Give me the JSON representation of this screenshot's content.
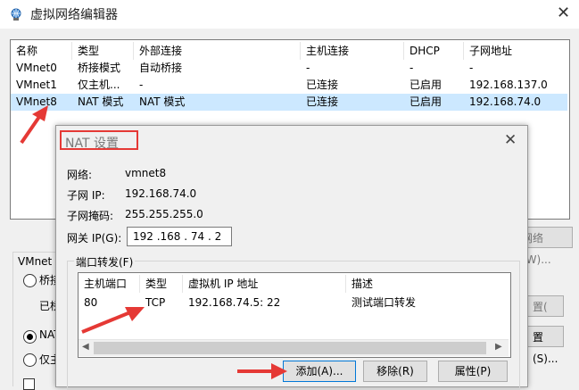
{
  "window": {
    "title": "虚拟网络编辑器",
    "close_glyph": "✕"
  },
  "networks": {
    "headers": [
      "名称",
      "类型",
      "外部连接",
      "主机连接",
      "DHCP",
      "子网地址"
    ],
    "rows": [
      [
        "VMnet0",
        "桥接模式",
        "自动桥接",
        "-",
        "-",
        "-"
      ],
      [
        "VMnet1",
        "仅主机...",
        "-",
        "已连接",
        "已启用",
        "192.168.137.0"
      ],
      [
        "VMnet8",
        "NAT 模式",
        "NAT 模式",
        "已连接",
        "已启用",
        "192.168.74.0"
      ]
    ],
    "selected_row": 2
  },
  "background": {
    "vmnet_info": "VMnet 信",
    "radio_bridge": "桥接",
    "bridged_to": "已桥",
    "radio_nat": "NAT",
    "radio_host": "仅主",
    "btn_network": "网络(W)...",
    "btn_r1": "置(",
    "btn_r2": "置(S)..."
  },
  "nat_dialog": {
    "title": "NAT 设置",
    "close_glyph": "✕",
    "network_label": "网络:",
    "network_value": "vmnet8",
    "subnet_ip_label": "子网 IP:",
    "subnet_ip_value": "192.168.74.0",
    "subnet_mask_label": "子网掩码:",
    "subnet_mask_value": "255.255.255.0",
    "gateway_label": "网关 IP(G):",
    "gateway_value": "192 .168 . 74 . 2",
    "port_forwarding_label": "端口转发(F)",
    "pf_headers": [
      "主机端口",
      "类型",
      "虚拟机 IP 地址",
      "描述"
    ],
    "pf_rows": [
      [
        "80",
        "TCP",
        "192.168.74.5: 22",
        "测试端口转发"
      ]
    ],
    "add_label": "添加(A)...",
    "remove_label": "移除(R)",
    "properties_label": "属性(P)"
  },
  "colors": {
    "annotation_red": "#e53935",
    "selection_blue": "#cce8ff",
    "focus_blue": "#0078d7"
  },
  "icons": [
    "network-globe-icon",
    "close-icon",
    "scroll-left-icon",
    "scroll-right-icon",
    "red-arrow-annotation"
  ]
}
